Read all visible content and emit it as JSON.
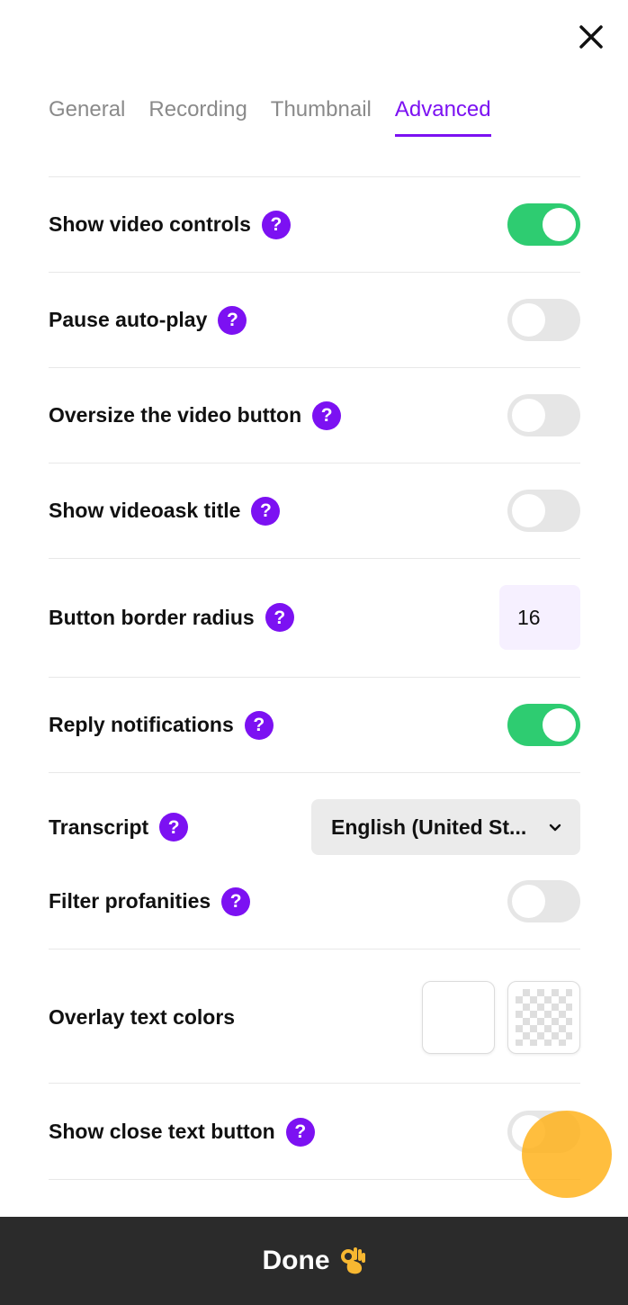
{
  "tabs": [
    "General",
    "Recording",
    "Thumbnail",
    "Advanced"
  ],
  "active_tab": "Advanced",
  "help_glyph": "?",
  "settings": {
    "show_video_controls": {
      "label": "Show video controls",
      "on": true
    },
    "pause_autoplay": {
      "label": "Pause auto-play",
      "on": false
    },
    "oversize_video_button": {
      "label": "Oversize the video button",
      "on": false
    },
    "show_videoask_title": {
      "label": "Show videoask title",
      "on": false
    },
    "button_border_radius": {
      "label": "Button border radius",
      "value": "16"
    },
    "reply_notifications": {
      "label": "Reply notifications",
      "on": true
    },
    "transcript": {
      "label": "Transcript",
      "selected": "English (United St..."
    },
    "filter_profanities": {
      "label": "Filter profanities",
      "on": false
    },
    "overlay_text_colors": {
      "label": "Overlay text colors",
      "swatches": [
        "#FFFFFF",
        "transparent"
      ]
    },
    "show_close_text_button": {
      "label": "Show close text button",
      "on": false
    }
  },
  "done_button": {
    "label": "Done",
    "icon": "ok-hand-icon"
  },
  "colors": {
    "accent": "#7C11F2",
    "toggle_on": "#2ECC71",
    "toggle_off": "#E6E6E6",
    "footer": "#2B2B2B"
  }
}
